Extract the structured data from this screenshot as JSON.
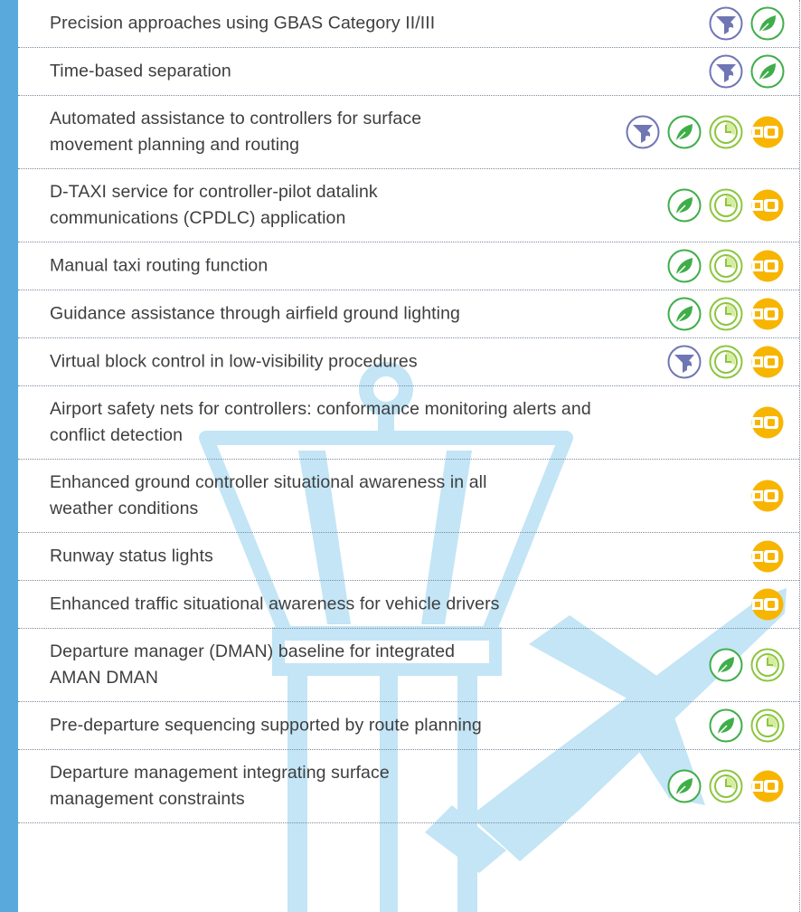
{
  "rows": [
    {
      "label_lines": [
        "Precision approaches using GBAS Category II/III"
      ],
      "icons": [
        "funnel-icon",
        "leaf-icon"
      ]
    },
    {
      "label_lines": [
        "Time-based separation"
      ],
      "icons": [
        "funnel-icon",
        "leaf-icon"
      ]
    },
    {
      "label_lines": [
        "Automated assistance to controllers for surface",
        "movement planning and routing"
      ],
      "icons": [
        "funnel-icon",
        "leaf-icon",
        "clock-icon",
        "seatbelt-icon"
      ]
    },
    {
      "label_lines": [
        "D-TAXI service for controller-pilot datalink",
        "communications (CPDLC) application"
      ],
      "icons": [
        "leaf-icon",
        "clock-icon",
        "seatbelt-icon"
      ]
    },
    {
      "label_lines": [
        "Manual taxi routing function"
      ],
      "icons": [
        "leaf-icon",
        "clock-icon",
        "seatbelt-icon"
      ]
    },
    {
      "label_lines": [
        "Guidance assistance through airfield ground lighting"
      ],
      "icons": [
        "leaf-icon",
        "clock-icon",
        "seatbelt-icon"
      ]
    },
    {
      "label_lines": [
        "Virtual block control in low-visibility procedures"
      ],
      "icons": [
        "funnel-icon",
        "clock-icon",
        "seatbelt-icon"
      ]
    },
    {
      "label_lines": [
        "Airport safety nets for controllers: conformance monitoring alerts and",
        "conflict detection"
      ],
      "icons": [
        "seatbelt-icon"
      ]
    },
    {
      "label_lines": [
        "Enhanced ground controller situational awareness in all",
        "weather conditions"
      ],
      "icons": [
        "seatbelt-icon"
      ]
    },
    {
      "label_lines": [
        "Runway status lights"
      ],
      "icons": [
        "seatbelt-icon"
      ]
    },
    {
      "label_lines": [
        "Enhanced traffic situational awareness for vehicle drivers"
      ],
      "icons": [
        "seatbelt-icon"
      ]
    },
    {
      "label_lines": [
        "Departure manager (DMAN) baseline for integrated",
        "AMAN DMAN"
      ],
      "icons": [
        "leaf-icon",
        "clock-icon"
      ]
    },
    {
      "label_lines": [
        "Pre-departure sequencing supported by route planning"
      ],
      "icons": [
        "leaf-icon",
        "clock-icon"
      ]
    },
    {
      "label_lines": [
        "Departure management integrating surface",
        "management constraints"
      ],
      "icons": [
        "leaf-icon",
        "clock-icon",
        "seatbelt-icon"
      ]
    }
  ],
  "colors": {
    "accent_bar": "#5aa9dc",
    "funnel": "#6f76b4",
    "leaf": "#3fae49",
    "clock": "#8cc63f",
    "seatbelt": "#f7b500",
    "background_art": "#bfe3f5"
  }
}
